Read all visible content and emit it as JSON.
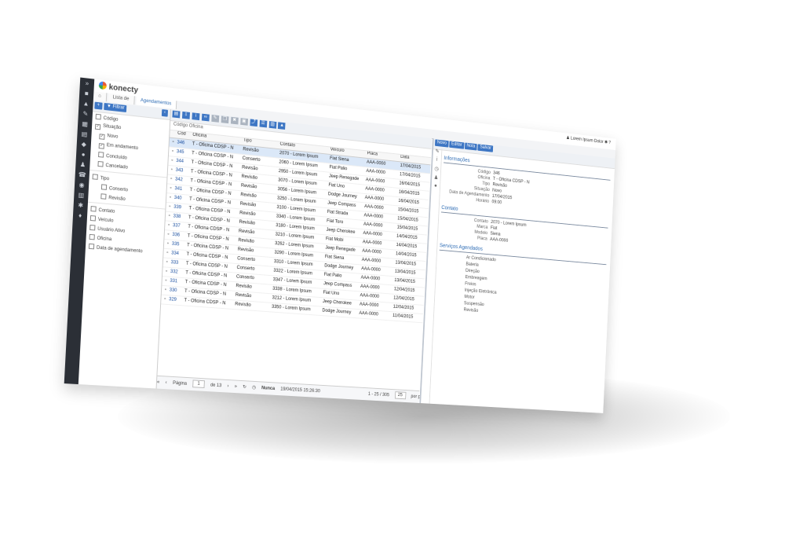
{
  "app": {
    "logo": "konecty"
  },
  "tabs": [
    {
      "label": "Lista de"
    },
    {
      "label": "Agendamentos"
    }
  ],
  "user": {
    "name": "Lorem Ipsum Dolor"
  },
  "left_panel": {
    "filter_label": "Filtrar",
    "items": [
      {
        "label": "Código",
        "checked": false,
        "indent": 0
      },
      {
        "label": "Situação",
        "checked": true,
        "indent": 0
      },
      {
        "label": "Novo",
        "checked": true,
        "indent": 1
      },
      {
        "label": "Em andamento",
        "checked": true,
        "indent": 1
      },
      {
        "label": "Concluído",
        "checked": false,
        "indent": 1
      },
      {
        "label": "Cancelado",
        "checked": false,
        "indent": 1
      },
      {
        "label": "Tipo",
        "checked": false,
        "indent": 0
      },
      {
        "label": "Conserto",
        "checked": false,
        "indent": 2
      },
      {
        "label": "Revisão",
        "checked": false,
        "indent": 2
      },
      {
        "label": "Contato",
        "checked": false,
        "indent": 0
      },
      {
        "label": "Veículo",
        "checked": false,
        "indent": 0
      },
      {
        "label": "Usuário Ativo",
        "checked": false,
        "indent": 0
      },
      {
        "label": "Oficina",
        "checked": false,
        "indent": 0
      },
      {
        "label": "Data de agendamento",
        "checked": false,
        "indent": 0
      }
    ]
  },
  "grid": {
    "group_bar": "Código  Oficina",
    "columns": [
      "",
      "Cód",
      "Oficina",
      "Tipo",
      "Contato",
      "Veículo",
      "Placa",
      "Data"
    ],
    "rows": [
      [
        "346",
        "T - Oficina CDSP - N",
        "Revisão",
        "2070 - Lorem Ipsum",
        "Fiat Siena",
        "AAA-0000",
        "17/04/2015"
      ],
      [
        "345",
        "T - Oficina CDSP - N",
        "Conserto",
        "2060 - Lorem Ipsum",
        "Fiat Palio",
        "AAA-0000",
        "17/04/2015"
      ],
      [
        "344",
        "T - Oficina CDSP - N",
        "Revisão",
        "2950 - Lorem Ipsum",
        "Jeep Renegade",
        "AAA-0000",
        "16/04/2015"
      ],
      [
        "343",
        "T - Oficina CDSP - N",
        "Revisão",
        "3070 - Lorem Ipsum",
        "Fiat Uno",
        "AAA-0000",
        "16/04/2015"
      ],
      [
        "342",
        "T - Oficina CDSP - N",
        "Revisão",
        "3056 - Lorem Ipsum",
        "Dodge Journey",
        "AAA-0000",
        "16/04/2015"
      ],
      [
        "341",
        "T - Oficina CDSP - N",
        "Revisão",
        "3250 - Lorem Ipsum",
        "Jeep Compass",
        "AAA-0000",
        "15/04/2015"
      ],
      [
        "340",
        "T - Oficina CDSP - N",
        "Revisão",
        "3100 - Lorem Ipsum",
        "Fiat Strada",
        "AAA-0000",
        "15/04/2015"
      ],
      [
        "339",
        "T - Oficina CDSP - N",
        "Revisão",
        "3340 - Lorem Ipsum",
        "Fiat Toro",
        "AAA-0000",
        "15/04/2015"
      ],
      [
        "338",
        "T - Oficina CDSP - N",
        "Revisão",
        "3180 - Lorem Ipsum",
        "Jeep Cherokee",
        "AAA-0000",
        "14/04/2015"
      ],
      [
        "337",
        "T - Oficina CDSP - N",
        "Revisão",
        "3210 - Lorem Ipsum",
        "Fiat Mobi",
        "AAA-0000",
        "14/04/2015"
      ],
      [
        "336",
        "T - Oficina CDSP - N",
        "Revisão",
        "3262 - Lorem Ipsum",
        "Jeep Renegade",
        "AAA-0000",
        "14/04/2015"
      ],
      [
        "335",
        "T - Oficina CDSP - N",
        "Revisão",
        "3290 - Lorem Ipsum",
        "Fiat Siena",
        "AAA-0000",
        "13/04/2015"
      ],
      [
        "334",
        "T - Oficina CDSP - N",
        "Conserto",
        "3310 - Lorem Ipsum",
        "Dodge Journey",
        "AAA-0000",
        "13/04/2015"
      ],
      [
        "333",
        "T - Oficina CDSP - N",
        "Conserto",
        "3322 - Lorem Ipsum",
        "Fiat Palio",
        "AAA-0000",
        "13/04/2015"
      ],
      [
        "332",
        "T - Oficina CDSP - N",
        "Conserto",
        "3347 - Lorem Ipsum",
        "Jeep Compass",
        "AAA-0000",
        "12/04/2015"
      ],
      [
        "331",
        "T - Oficina CDSP - N",
        "Revisão",
        "3338 - Lorem Ipsum",
        "Fiat Uno",
        "AAA-0000",
        "12/04/2015"
      ],
      [
        "330",
        "T - Oficina CDSP - N",
        "Revisão",
        "3212 - Lorem Ipsum",
        "Jeep Cherokee",
        "AAA-0000",
        "12/04/2015"
      ],
      [
        "329",
        "T - Oficina CDSP - N",
        "Revisão",
        "3350 - Lorem Ipsum",
        "Dodge Journey",
        "AAA-0000",
        "11/04/2015"
      ]
    ]
  },
  "pager": {
    "page_label": "Página",
    "page_value": "1",
    "page_of": "de 13",
    "refresh_label": "Nunca",
    "timestamp": "19/04/2015 15:26:30",
    "range": "1 - 25 / 305",
    "per_page_value": "25",
    "per_page_label": "por página"
  },
  "detail": {
    "toolbar": [
      "Novo",
      "Editar",
      "Nota",
      "Salvar"
    ],
    "sections": [
      {
        "title": "Informações",
        "fields": [
          {
            "k": "Código",
            "v": "346"
          },
          {
            "k": "Oficina",
            "v": "T - Oficina CDSP - N"
          },
          {
            "k": "Tipo",
            "v": "Revisão"
          },
          {
            "k": "Situação",
            "v": "Novo"
          },
          {
            "k": "Data de Agendamento",
            "v": "17/04/2015"
          },
          {
            "k": "Horário",
            "v": "09:00"
          }
        ]
      },
      {
        "title": "Contato",
        "fields": [
          {
            "k": "Contato",
            "v": "2070 - Lorem Ipsum"
          },
          {
            "k": "Marca",
            "v": "Fiat"
          },
          {
            "k": "Modelo",
            "v": "Siena"
          },
          {
            "k": "Placa",
            "v": "AAA-0000"
          }
        ]
      },
      {
        "title": "Serviços Agendados",
        "list": [
          "Ar Condicionado",
          "Bateria",
          "Direção",
          "Embreagem",
          "Freios",
          "Injeção Eletrônica",
          "Motor",
          "Suspensão",
          "Revisão"
        ]
      }
    ]
  }
}
